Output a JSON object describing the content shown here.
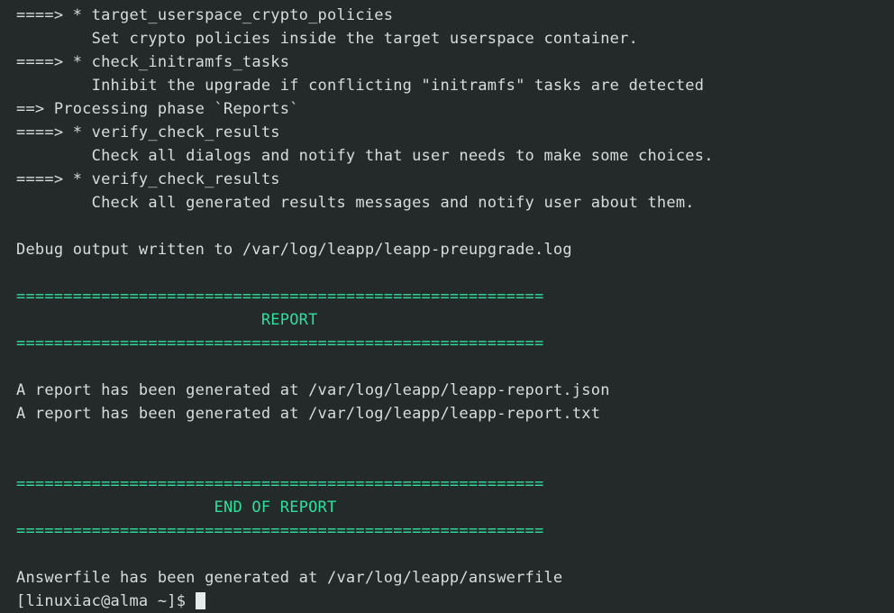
{
  "terminal": {
    "title": "leapp preupgrade terminal output",
    "background_color": "#24292a",
    "foreground_color": "#d9dcdc",
    "accent_green": "#2fdf9e",
    "cursor_color": "#e7eaea",
    "prompt": "[linuxiac@alma ~]$",
    "lines": [
      {
        "id": "l01",
        "text": "====> * target_userspace_crypto_policies",
        "color": "white"
      },
      {
        "id": "l02",
        "text": "        Set crypto policies inside the target userspace container.",
        "color": "white"
      },
      {
        "id": "l03",
        "text": "====> * check_initramfs_tasks",
        "color": "white"
      },
      {
        "id": "l04",
        "text": "        Inhibit the upgrade if conflicting \"initramfs\" tasks are detected",
        "color": "white"
      },
      {
        "id": "l05",
        "text": "==> Processing phase `Reports`",
        "color": "white"
      },
      {
        "id": "l06",
        "text": "====> * verify_check_results",
        "color": "white"
      },
      {
        "id": "l07",
        "text": "        Check all dialogs and notify that user needs to make some choices.",
        "color": "white"
      },
      {
        "id": "l08",
        "text": "====> * verify_check_results",
        "color": "white"
      },
      {
        "id": "l09",
        "text": "        Check all generated results messages and notify user about them.",
        "color": "white"
      },
      {
        "id": "l10",
        "text": "",
        "color": "white"
      },
      {
        "id": "l11",
        "text": "Debug output written to /var/log/leapp/leapp-preupgrade.log",
        "color": "white"
      },
      {
        "id": "l12",
        "text": "",
        "color": "white"
      },
      {
        "id": "l13",
        "text": "========================================================",
        "color": "green"
      },
      {
        "id": "l14",
        "text": "                          REPORT",
        "color": "green"
      },
      {
        "id": "l15",
        "text": "========================================================",
        "color": "green"
      },
      {
        "id": "l16",
        "text": "",
        "color": "white"
      },
      {
        "id": "l17",
        "text": "A report has been generated at /var/log/leapp/leapp-report.json",
        "color": "white"
      },
      {
        "id": "l18",
        "text": "A report has been generated at /var/log/leapp/leapp-report.txt",
        "color": "white"
      },
      {
        "id": "l19",
        "text": "",
        "color": "white"
      },
      {
        "id": "l20",
        "text": "",
        "color": "white"
      },
      {
        "id": "l21",
        "text": "========================================================",
        "color": "green"
      },
      {
        "id": "l22",
        "text": "                     END OF REPORT",
        "color": "green"
      },
      {
        "id": "l23",
        "text": "========================================================",
        "color": "green"
      },
      {
        "id": "l24",
        "text": "",
        "color": "white"
      },
      {
        "id": "l25",
        "text": "Answerfile has been generated at /var/log/leapp/answerfile",
        "color": "white"
      }
    ]
  }
}
